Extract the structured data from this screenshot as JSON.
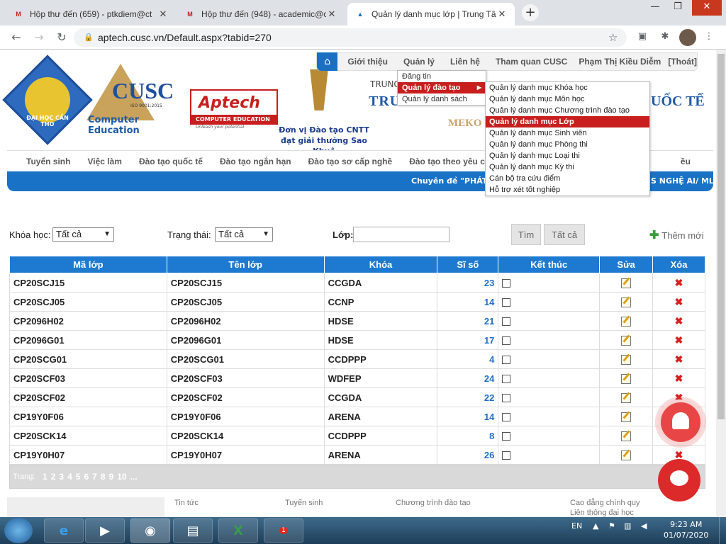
{
  "browser": {
    "tabs": [
      {
        "title": "Hộp thư đến (659) - ptkdiem@ct",
        "icon": "gmail-icon"
      },
      {
        "title": "Hộp thư đến (948) - academic@c",
        "icon": "gmail-icon"
      },
      {
        "title": "Quản lý danh mục lớp | Trung Tâ",
        "icon": "aptech-icon"
      }
    ],
    "url": "aptech.cusc.vn/Default.aspx?tabid=270"
  },
  "topnav": {
    "items": [
      "Giới thiệu",
      "Quản lý",
      "Liên hệ",
      "Tham quan CUSC",
      "Phạm Thị Kiều Diễm",
      "[Thoát]"
    ]
  },
  "header": {
    "cusc_word": "CUSC",
    "cusc_iso": "ISO 9001:2015",
    "cusc_sub": "Computer Education",
    "aptech_word": "Aptech",
    "aptech_sub": "COMPUTER EDUCATION",
    "aptech_tag": "Unleash your potential",
    "award_line1": "Đơn vị Đào tạo CNTT",
    "award_line2": "đạt giải thưởng Sao Khuê",
    "logo_text": "ĐẠI HỌC CẦN THƠ",
    "center_line1": "TRUNG",
    "center_line2": "TRUNG TÂM ĐÀO",
    "center_line2b": "UỐC TẾ",
    "center_line3": "MEKO"
  },
  "mainnav": {
    "items": [
      "Tuyển sinh",
      "Việc làm",
      "Đào tạo quốc tế",
      "Đào tạo ngắn hạn",
      "Đào tạo sơ cấp nghề",
      "Đào tạo theo yêu cầu"
    ],
    "trailing": "ều"
  },
  "bluebar": {
    "left": "Chuyên đề \"PHÁT TR",
    "right": "S NGHỆ AI/ ML\""
  },
  "menu_level1": {
    "items": [
      {
        "label": "Đăng tin",
        "selected": false
      },
      {
        "label": "Quản lý đào tạo",
        "selected": true
      },
      {
        "label": "Quản lý danh sách",
        "selected": false
      }
    ]
  },
  "menu_level2": {
    "items": [
      {
        "label": "Quản lý danh mục Khóa học",
        "selected": false
      },
      {
        "label": "Quản lý danh mục Môn học",
        "selected": false
      },
      {
        "label": "Quản lý danh mục Chương trình đào tạo",
        "selected": false
      },
      {
        "label": "Quản lý danh mục Lớp",
        "selected": true
      },
      {
        "label": "Quản lý danh mục Sinh viên",
        "selected": false
      },
      {
        "label": "Quản lý danh mục Phòng thi",
        "selected": false
      },
      {
        "label": "Quản lý danh mục Loại thi",
        "selected": false
      },
      {
        "label": "Quản lý danh mục Kỳ thi",
        "selected": false
      },
      {
        "label": "Cán bộ tra cứu điểm",
        "selected": false
      },
      {
        "label": "Hỗ trợ xét tốt nghiệp",
        "selected": false
      }
    ]
  },
  "filter": {
    "khoahoc_label": "Khóa học:",
    "khoahoc_value": "Tất cả",
    "trangthai_label": "Trạng thái:",
    "trangthai_value": "Tất cả",
    "lop_label": "Lớp:",
    "lop_value": "",
    "tim_label": "Tìm",
    "tatca_label": "Tất cả",
    "themmoi_label": "Thêm mới"
  },
  "table": {
    "headers": [
      "Mã lớp",
      "Tên lớp",
      "Khóa",
      "Sĩ số",
      "Kết thúc",
      "Sửa",
      "Xóa"
    ],
    "rows": [
      {
        "ma": "CP20SCJ15",
        "ten": "CP20SCJ15",
        "khoa": "CCGDA",
        "siso": "23"
      },
      {
        "ma": "CP20SCJ05",
        "ten": "CP20SCJ05",
        "khoa": "CCNP",
        "siso": "14"
      },
      {
        "ma": "CP2096H02",
        "ten": "CP2096H02",
        "khoa": "HDSE",
        "siso": "21"
      },
      {
        "ma": "CP2096G01",
        "ten": "CP2096G01",
        "khoa": "HDSE",
        "siso": "17"
      },
      {
        "ma": "CP20SCG01",
        "ten": "CP20SCG01",
        "khoa": "CCDPPP",
        "siso": "4"
      },
      {
        "ma": "CP20SCF03",
        "ten": "CP20SCF03",
        "khoa": "WDFEP",
        "siso": "24"
      },
      {
        "ma": "CP20SCF02",
        "ten": "CP20SCF02",
        "khoa": "CCGDA",
        "siso": "22"
      },
      {
        "ma": "CP19Y0F06",
        "ten": "CP19Y0F06",
        "khoa": "ARENA",
        "siso": "14"
      },
      {
        "ma": "CP20SCK14",
        "ten": "CP20SCK14",
        "khoa": "CCDPPP",
        "siso": "8"
      },
      {
        "ma": "CP19Y0H07",
        "ten": "CP19Y0H07",
        "khoa": "ARENA",
        "siso": "26"
      }
    ]
  },
  "pager": {
    "label": "Trang:",
    "pages": [
      "1",
      "2",
      "3",
      "4",
      "5",
      "6",
      "7",
      "8",
      "9",
      "10",
      "..."
    ]
  },
  "footer": {
    "cols": [
      "Tin tức",
      "Tuyển sinh",
      "Chương trình đào tạo",
      "Cao đẳng chính quy",
      "Liên thông đại học"
    ]
  },
  "taskbar": {
    "lang": "EN",
    "time": "9:23 AM",
    "date": "01/07/2020",
    "zalo_badge": "1"
  },
  "colors": {
    "accent_blue": "#1e7ad0",
    "menu_selected_red": "#c81e1e"
  }
}
